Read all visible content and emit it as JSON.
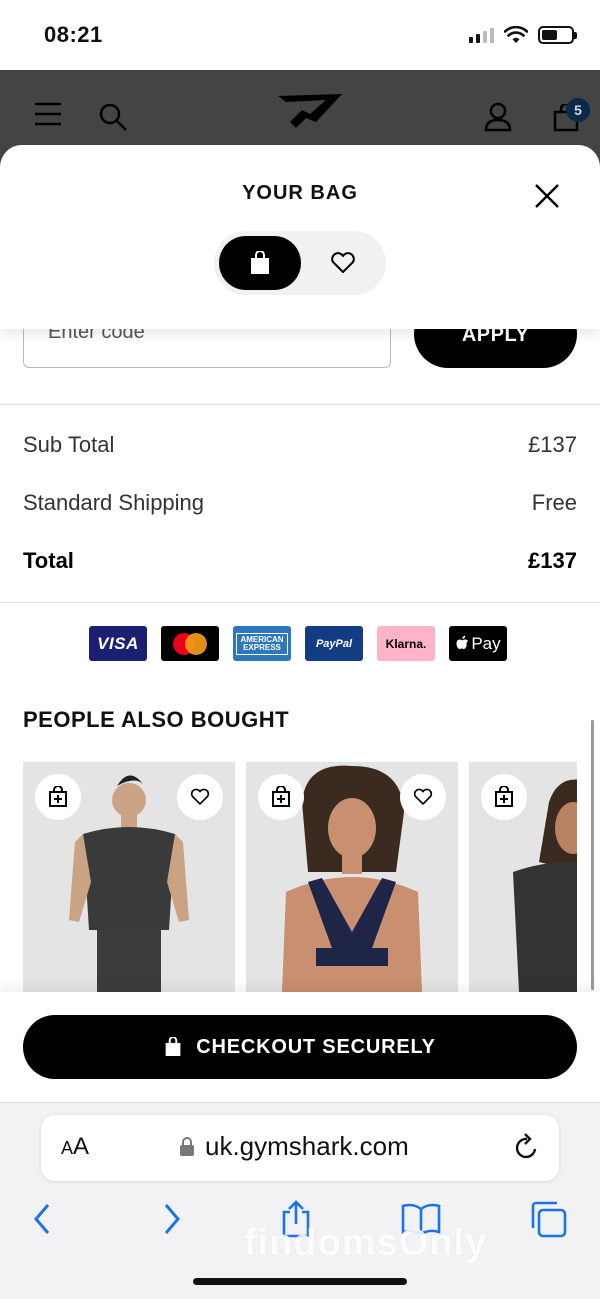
{
  "status_bar": {
    "time": "08:21"
  },
  "header": {
    "cart_count": "5"
  },
  "sheet": {
    "title": "YOUR BAG"
  },
  "promo": {
    "placeholder": "Enter code",
    "apply_label": "APPLY"
  },
  "summary": {
    "subtotal_label": "Sub Total",
    "subtotal_value": "£137",
    "shipping_label": "Standard Shipping",
    "shipping_value": "Free",
    "total_label": "Total",
    "total_value": "£137"
  },
  "payments": {
    "visa": "VISA",
    "amex_line1": "AMERICAN",
    "amex_line2": "EXPRESS",
    "paypal": "PayPal",
    "klarna": "Klarna.",
    "applepay": "Pay"
  },
  "recommendations": {
    "title": "PEOPLE ALSO BOUGHT"
  },
  "checkout": {
    "label": "CHECKOUT SECURELY"
  },
  "browser": {
    "aa": "A",
    "aa_small": "A",
    "url": "uk.gymshark.com"
  },
  "watermark": "findomsOnly"
}
